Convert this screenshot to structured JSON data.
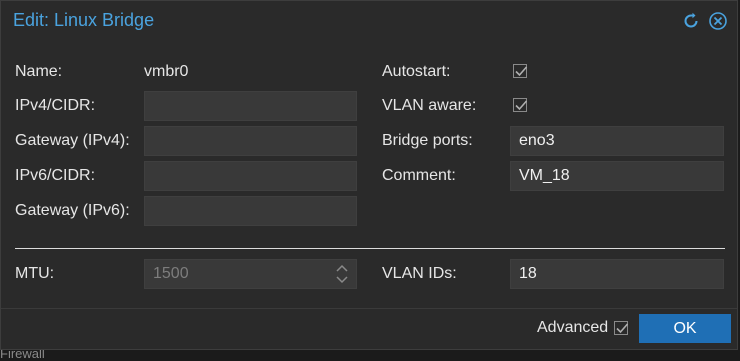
{
  "dialog": {
    "title": "Edit: Linux Bridge",
    "reset_icon": "reset-icon",
    "close_icon": "close-icon"
  },
  "left": {
    "name_label": "Name:",
    "name_value": "vmbr0",
    "ipv4_label": "IPv4/CIDR:",
    "ipv4_value": "",
    "gw4_label": "Gateway (IPv4):",
    "gw4_value": "",
    "ipv6_label": "IPv6/CIDR:",
    "ipv6_value": "",
    "gw6_label": "Gateway (IPv6):",
    "gw6_value": ""
  },
  "right": {
    "autostart_label": "Autostart:",
    "autostart_checked": true,
    "vlan_aware_label": "VLAN aware:",
    "vlan_aware_checked": true,
    "bridge_ports_label": "Bridge ports:",
    "bridge_ports_value": "eno3",
    "comment_label": "Comment:",
    "comment_value": "VM_18"
  },
  "advanced": {
    "mtu_label": "MTU:",
    "mtu_value": "1500",
    "vlan_ids_label": "VLAN IDs:",
    "vlan_ids_value": "18"
  },
  "footer": {
    "advanced_label": "Advanced",
    "advanced_checked": true,
    "ok_label": "OK"
  },
  "background_fragment": "Firewall",
  "colors": {
    "accent": "#4aa3df",
    "ok_button": "#1f6fb5",
    "dialog_bg": "#2a2a2a",
    "field_bg": "#393939"
  }
}
